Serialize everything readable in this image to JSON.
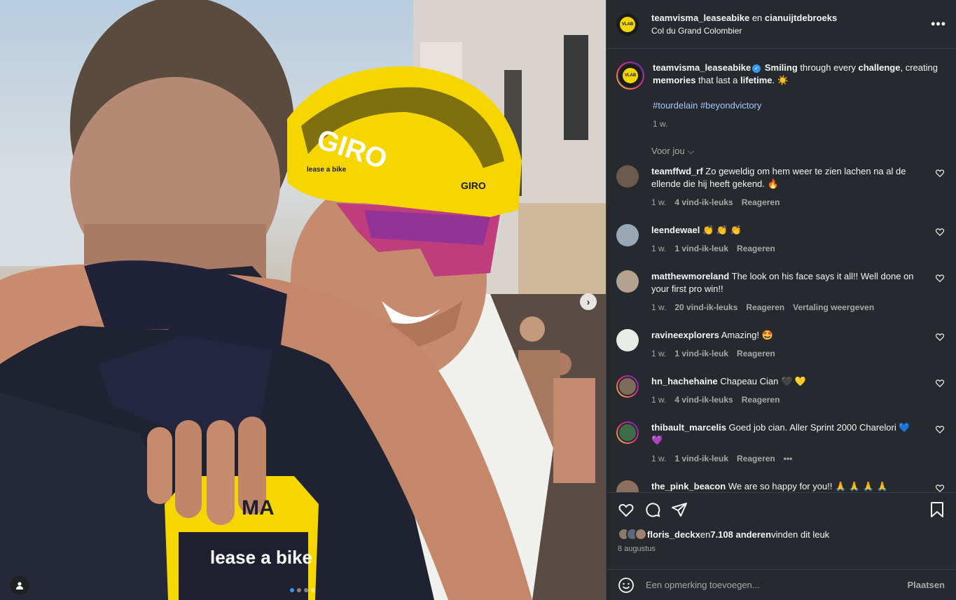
{
  "header": {
    "user1": "teamvisma_leaseabike",
    "joiner": " en ",
    "user2": "cianuijtdebroeks",
    "location": "Col du Grand Colombier",
    "more": "•••"
  },
  "caption": {
    "username": "teamvisma_leaseabike",
    "text_parts": [
      "Smiling",
      " through every ",
      "challenge",
      ",",
      " creating ",
      "memories",
      " that last a ",
      "lifetime",
      ". ☀️"
    ],
    "hashtags": "#tourdelain #beyondvictory",
    "time": "1 w."
  },
  "voor_jou": "Voor jou ⌵",
  "comments": [
    {
      "username": "teamffwd_rf",
      "text": " Zo geweldig om hem weer te zien lachen na al de ellende die hij heeft gekend. 🔥",
      "time": "1 w.",
      "likes": "4 vind-ik-leuks",
      "reply": "Reageren",
      "extra": "",
      "avatar_color": "#6b5b4e"
    },
    {
      "username": "leendewael",
      "text": " 👏 👏 👏",
      "time": "1 w.",
      "likes": "1 vind-ik-leuk",
      "reply": "Reageren",
      "extra": "",
      "avatar_color": "#9aa8b6"
    },
    {
      "username": "matthewmoreland",
      "text": " The look on his face says it all!! Well done on your first pro win!!",
      "time": "1 w.",
      "likes": "20 vind-ik-leuks",
      "reply": "Reageren",
      "extra": "Vertaling weergeven",
      "avatar_color": "#b3a28f"
    },
    {
      "username": "ravineexplorers",
      "text": " Amazing! 🤩",
      "time": "1 w.",
      "likes": "1 vind-ik-leuk",
      "reply": "Reageren",
      "extra": "",
      "avatar_color": "#e9ece7"
    },
    {
      "username": "hn_hachehaine",
      "text": " Chapeau Cian 🖤 💛",
      "time": "1 w.",
      "likes": "4 vind-ik-leuks",
      "reply": "Reageren",
      "extra": "",
      "avatar_color": "#7c6a5a"
    },
    {
      "username": "thibault_marcelis",
      "text": " Goed job cian. Aller Sprint 2000 Charelori 💙 💜",
      "time": "1 w.",
      "likes": "1 vind-ik-leuk",
      "reply": "Reageren",
      "extra": "•••",
      "avatar_color": "#3e6c4a"
    },
    {
      "username": "the_pink_beacon",
      "text": " We are so happy for you!! 🙏 🙏 🙏 🙏",
      "time": "",
      "likes": "",
      "reply": "",
      "extra": "",
      "avatar_color": "#8c6f5c"
    }
  ],
  "likes": {
    "user": "floris_deckx",
    "middle": " en ",
    "count": "7.108 anderen",
    "suffix": " vinden dit leuk",
    "date": "8 augustus"
  },
  "add_comment": {
    "placeholder": "Een opmerking toevoegen...",
    "post": "Plaatsen"
  },
  "photo_text": {
    "helmet_brand": "GIRO",
    "helmet_brand2": "GIRO",
    "jersey_top": "MA",
    "jersey_bottom": "lease a bike",
    "helmet_side": "lease a bike"
  },
  "colors": {
    "panel_bg": "#262a2f",
    "accent_blue": "#3797f0",
    "hashtag": "#a5c7ff",
    "team_yellow": "#f6d600"
  }
}
